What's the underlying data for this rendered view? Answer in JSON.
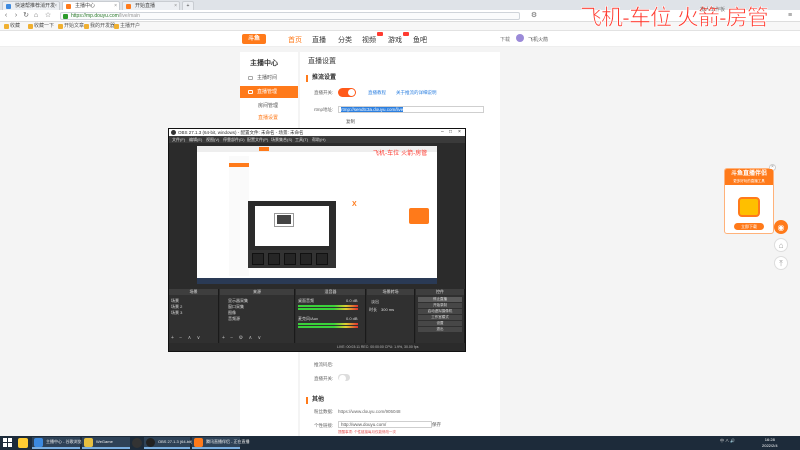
{
  "browser": {
    "tabs": [
      {
        "label": "快速帮推荐消开发"
      },
      {
        "label": "主播中心"
      },
      {
        "label": "开始直播"
      }
    ],
    "url_domain": "https://mp.douyu.com",
    "url_path": "/live/main",
    "bookmarks": [
      "收藏",
      "收藏一下",
      "开始文章",
      "我的开发器",
      "主播开户"
    ]
  },
  "site": {
    "logo_text": "斗鱼",
    "nav": [
      "首页",
      "直播",
      "分类",
      "视频",
      "游戏",
      "鱼吧"
    ],
    "header_right": "下载",
    "username": "飞机火箭"
  },
  "overlay": {
    "text": "飞机-车位 火箭-房管",
    "sub": "加人工作板"
  },
  "leftnav": {
    "title": "主播中心",
    "items": [
      "主播时间",
      "直播管理"
    ],
    "subitems": [
      "房间管理",
      "直播设置"
    ]
  },
  "main": {
    "page_title": "直播设置",
    "section1": "推流设置",
    "live_switch_label": "直播开关:",
    "link_tutorial": "直播教程",
    "link_help": "关于推流的详细说明",
    "rtmp_label": "rtmp地址:",
    "rtmp_value": "rtmp://sendtc3a.douyu.com/live",
    "copy_label": "复制",
    "mid_label1": "推流码后:",
    "mid_label2": "直播开关:",
    "section2": "其他",
    "fans_label": "粉丝数据:",
    "fans_url": "https://www.douyu.com/905048",
    "share_label": "个性链接:",
    "share_url": "http://www.douyu.com/",
    "share_btn": "保存",
    "share_note": "提醒事项: 个性链接每月仅能修改一次"
  },
  "obs": {
    "title": "OBS 27.1.3 (64-bit, windows) - 配置文件: 未命名 - 场景: 未命名",
    "menu": [
      "文件(F)",
      "编辑(E)",
      "视图(V)",
      "停靠部件(D)",
      "配置文件(P)",
      "场景集合(S)",
      "工具(T)",
      "帮助(H)"
    ],
    "preview_red": "飞机-车位 火箭-房管",
    "docks": {
      "scenes": {
        "title": "场景",
        "items": [
          "场景",
          "场景 2",
          "场景 3"
        ]
      },
      "sources": {
        "title": "来源",
        "items": [
          "显示器采集",
          "窗口采集",
          "图像",
          "音频源"
        ]
      },
      "mixer": {
        "title": "混音器",
        "items": [
          "桌面音频",
          "麦克风/Aux"
        ],
        "db1": "0.0 dB",
        "db2": "0.0 dB"
      },
      "transitions": {
        "title": "场景转场",
        "fade": "淡出",
        "duration_label": "时长",
        "duration": "300 ms"
      },
      "controls": {
        "title": "控件",
        "buttons": [
          "停止直播",
          "开始录制",
          "启动虚拟摄像机",
          "工作室模式",
          "设置",
          "退出"
        ]
      }
    },
    "status": "LIVE: 00:03:11   REC: 00:00:00   CPU: 1.9%, 30.00 fps"
  },
  "promo": {
    "title": "斗鱼直播伴侣",
    "subtitle": "更多好玩的直播工具",
    "button": "立即下载"
  },
  "taskbar": {
    "tasks": [
      "主播中心 - 谷歌浏览器",
      "WeGame",
      "OBS 27.1.3 (64-bit)",
      "腾讯直播伴侣 - 正在直播"
    ],
    "tray": "中 ∧ 🔊",
    "time": "16:28",
    "date": "2022/2/4"
  }
}
